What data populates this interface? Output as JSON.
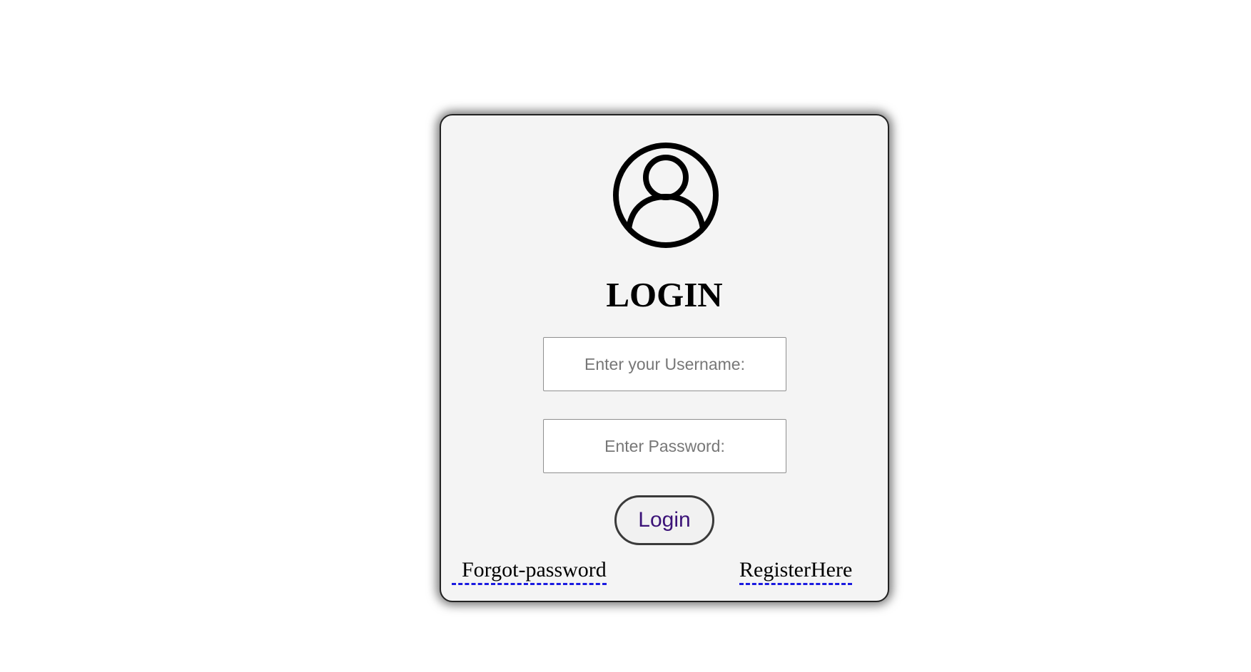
{
  "login_form": {
    "avatar_icon": "user-circle-icon",
    "title": "LOGIN",
    "username": {
      "placeholder": "Enter your Username:",
      "value": ""
    },
    "password": {
      "placeholder": "Enter Password:",
      "value": ""
    },
    "submit_label": "Login",
    "forgot_link": "Forgot-password",
    "register_link": "RegisterHere"
  },
  "colors": {
    "card_background": "#f4f4f4",
    "button_text": "#3b1278",
    "link_underline": "#1a1ae0"
  }
}
